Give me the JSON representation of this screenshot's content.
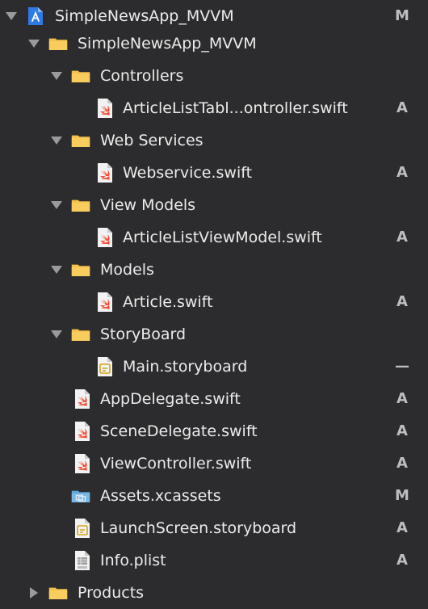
{
  "navigator": {
    "items": [
      {
        "label": "SimpleNewsApp_MVVM",
        "status": "M",
        "icon": "xcode-project-icon"
      },
      {
        "label": "SimpleNewsApp_MVVM",
        "status": "",
        "icon": "folder-icon"
      },
      {
        "label": "Controllers",
        "status": "",
        "icon": "folder-icon"
      },
      {
        "label": "ArticleListTabl...ontroller.swift",
        "status": "A",
        "icon": "swift-file-icon"
      },
      {
        "label": "Web Services",
        "status": "",
        "icon": "folder-icon"
      },
      {
        "label": "Webservice.swift",
        "status": "A",
        "icon": "swift-file-icon"
      },
      {
        "label": "View Models",
        "status": "",
        "icon": "folder-icon"
      },
      {
        "label": "ArticleListViewModel.swift",
        "status": "A",
        "icon": "swift-file-icon"
      },
      {
        "label": "Models",
        "status": "",
        "icon": "folder-icon"
      },
      {
        "label": "Article.swift",
        "status": "A",
        "icon": "swift-file-icon"
      },
      {
        "label": "StoryBoard",
        "status": "",
        "icon": "folder-icon"
      },
      {
        "label": "Main.storyboard",
        "status": "—",
        "icon": "storyboard-file-icon"
      },
      {
        "label": "AppDelegate.swift",
        "status": "A",
        "icon": "swift-file-icon"
      },
      {
        "label": "SceneDelegate.swift",
        "status": "A",
        "icon": "swift-file-icon"
      },
      {
        "label": "ViewController.swift",
        "status": "A",
        "icon": "swift-file-icon"
      },
      {
        "label": "Assets.xcassets",
        "status": "M",
        "icon": "asset-catalog-icon"
      },
      {
        "label": "LaunchScreen.storyboard",
        "status": "A",
        "icon": "storyboard-file-icon"
      },
      {
        "label": "Info.plist",
        "status": "A",
        "icon": "plist-file-icon"
      },
      {
        "label": "Products",
        "status": "",
        "icon": "folder-icon"
      }
    ]
  },
  "colors": {
    "background": "#2c2c2e",
    "folder": "#f5c04a",
    "swift": "#f05138",
    "assets": "#7ab8e6"
  }
}
